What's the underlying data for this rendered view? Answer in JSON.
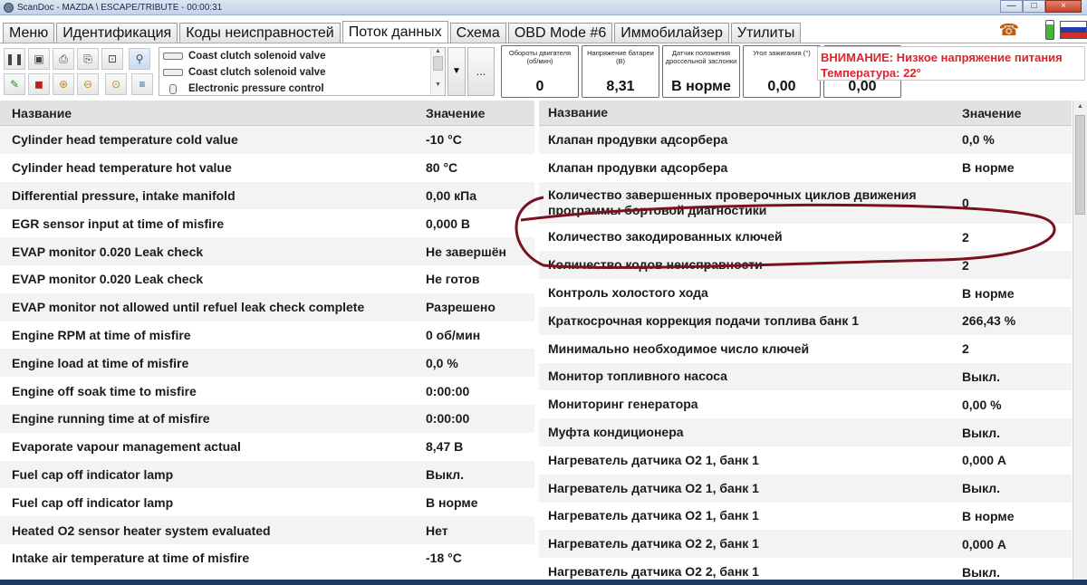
{
  "window": {
    "title": "ScanDoc - MAZDA \\ ESCAPE/TRIBUTE - 00:00:31"
  },
  "window_buttons": {
    "minimize": "—",
    "maximize": "□",
    "close": "×"
  },
  "tabs": [
    {
      "label": "Меню",
      "active": false
    },
    {
      "label": "Идентификация",
      "active": false
    },
    {
      "label": "Коды неисправностей",
      "active": false
    },
    {
      "label": "Поток данных",
      "active": true
    },
    {
      "label": "Схема",
      "active": false
    },
    {
      "label": "OBD Mode #6",
      "active": false
    },
    {
      "label": "Иммобилайзер",
      "active": false
    },
    {
      "label": "Утилиты",
      "active": false
    }
  ],
  "toolbar": {
    "param_list": [
      {
        "label": "Coast clutch solenoid valve",
        "icon": "relay-icon"
      },
      {
        "label": "Coast clutch solenoid valve",
        "icon": "relay-icon"
      },
      {
        "label": "Electronic pressure control",
        "icon": "valve-icon"
      }
    ],
    "more_label": "...",
    "dropdown_label": "▼"
  },
  "gauges": [
    {
      "label": "Обороты двигателя (об/мин)",
      "value": "0"
    },
    {
      "label": "Напряжение батареи (В)",
      "value": "8,31"
    },
    {
      "label": "Датчик положения дроссельной заслонки",
      "value": "В норме"
    },
    {
      "label": "Угол зажигания (°)",
      "value": "0,00"
    },
    {
      "label": "",
      "value": "0,00"
    }
  ],
  "warning": {
    "line1": "ВНИМАНИЕ: Низкое напряжение питания",
    "line2": "Температура: 22°"
  },
  "left_table": {
    "headers": [
      "Название",
      "Значение"
    ],
    "rows": [
      {
        "name": "Cylinder head temperature cold value",
        "value": "-10 °C"
      },
      {
        "name": "Cylinder head temperature hot value",
        "value": "80 °C"
      },
      {
        "name": "Differential pressure, intake manifold",
        "value": "0,00 кПа"
      },
      {
        "name": "EGR sensor input at time of misfire",
        "value": "0,000 В"
      },
      {
        "name": "EVAP monitor 0.020 Leak check",
        "value": "Не завершён"
      },
      {
        "name": "EVAP monitor 0.020 Leak check",
        "value": "Не готов"
      },
      {
        "name": "EVAP monitor not allowed until refuel leak check complete",
        "value": "Разрешено"
      },
      {
        "name": "Engine RPM at time of misfire",
        "value": "0 об/мин"
      },
      {
        "name": "Engine load at time of misfire",
        "value": "0,0 %"
      },
      {
        "name": "Engine off soak time to misfire",
        "value": "0:00:00"
      },
      {
        "name": "Engine running time at of misfire",
        "value": "0:00:00"
      },
      {
        "name": "Evaporate vapour management actual",
        "value": "8,47 В"
      },
      {
        "name": "Fuel cap off indicator lamp",
        "value": "Выкл."
      },
      {
        "name": "Fuel cap off indicator lamp",
        "value": "В норме"
      },
      {
        "name": "Heated O2 sensor heater system evaluated",
        "value": "Нет"
      },
      {
        "name": "Intake air temperature at time of misfire",
        "value": "-18 °C"
      }
    ]
  },
  "right_table": {
    "headers": [
      "Название",
      "Значение"
    ],
    "rows": [
      {
        "name": "Клапан продувки адсорбера",
        "value": "0,0 %"
      },
      {
        "name": "Клапан продувки адсорбера",
        "value": "В норме"
      },
      {
        "name": "Количество завершенных проверочных циклов движения программы бортовой диагностики",
        "value": "0"
      },
      {
        "name": "Количество закодированных ключей",
        "value": "2"
      },
      {
        "name": "Количество кодов неисправности",
        "value": "2"
      },
      {
        "name": "Контроль холостого хода",
        "value": "В норме"
      },
      {
        "name": "Краткосрочная коррекция подачи топлива банк 1",
        "value": "266,43 %"
      },
      {
        "name": "Минимально необходимое число ключей",
        "value": "2"
      },
      {
        "name": "Монитор топливного насоса",
        "value": "Выкл."
      },
      {
        "name": "Мониторинг генератора",
        "value": "0,00 %"
      },
      {
        "name": "Муфта кондиционера",
        "value": "Выкл."
      },
      {
        "name": "Нагреватель датчика O2 1, банк 1",
        "value": "0,000 А"
      },
      {
        "name": "Нагреватель датчика O2 1, банк 1",
        "value": "Выкл."
      },
      {
        "name": "Нагреватель датчика O2 1, банк 1",
        "value": "В норме"
      },
      {
        "name": "Нагреватель датчика O2 2, банк 1",
        "value": "0,000 А"
      },
      {
        "name": "Нагреватель датчика O2 2, банк 1",
        "value": "Выкл."
      }
    ]
  },
  "colors": {
    "warning_text": "#e0222a",
    "annotation_ellipse": "#7a1020",
    "header_bg": "#e2e2e2",
    "row_stripe": "#f3f3f3"
  },
  "icons": {
    "phone": "phone-icon",
    "battery": "battery-icon",
    "flag": "russian-flag-icon"
  }
}
